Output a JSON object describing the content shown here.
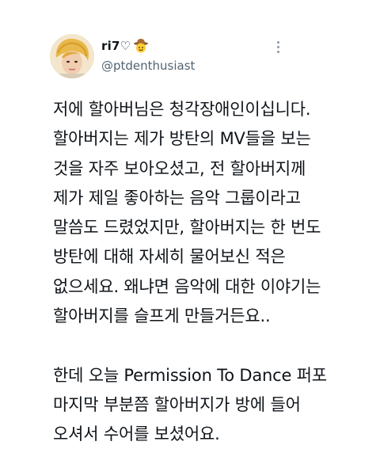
{
  "tweet": {
    "author": {
      "display_name": "ri7♡",
      "emoji_icon": "cowboy-hat-face-emoji",
      "handle": "@ptdenthusiast"
    },
    "more_icon": "more-options-icon",
    "body_paragraphs": [
      [
        "저에 할아버님은 청각장애인이십니다.",
        "할아버지는 제가 방탄의 MV들을 보는",
        "것을 자주 보아오셨고, 전 할아버지께",
        "제가 제일 좋아하는 음악 그룹이라고",
        "말씀도 드렸었지만, 할아버지는 한 번도",
        "방탄에 대해 자세히 물어보신 적은",
        "없으세요. 왜냐면 음악에 대한 이야기는",
        "할아버지를 슬프게 만들거든요.."
      ],
      [
        "한데 오늘 Permission To Dance 퍼포",
        "마지막 부분쯤 할아버지가 방에 들어",
        "오셔서 수어를 보셨어요."
      ]
    ]
  }
}
